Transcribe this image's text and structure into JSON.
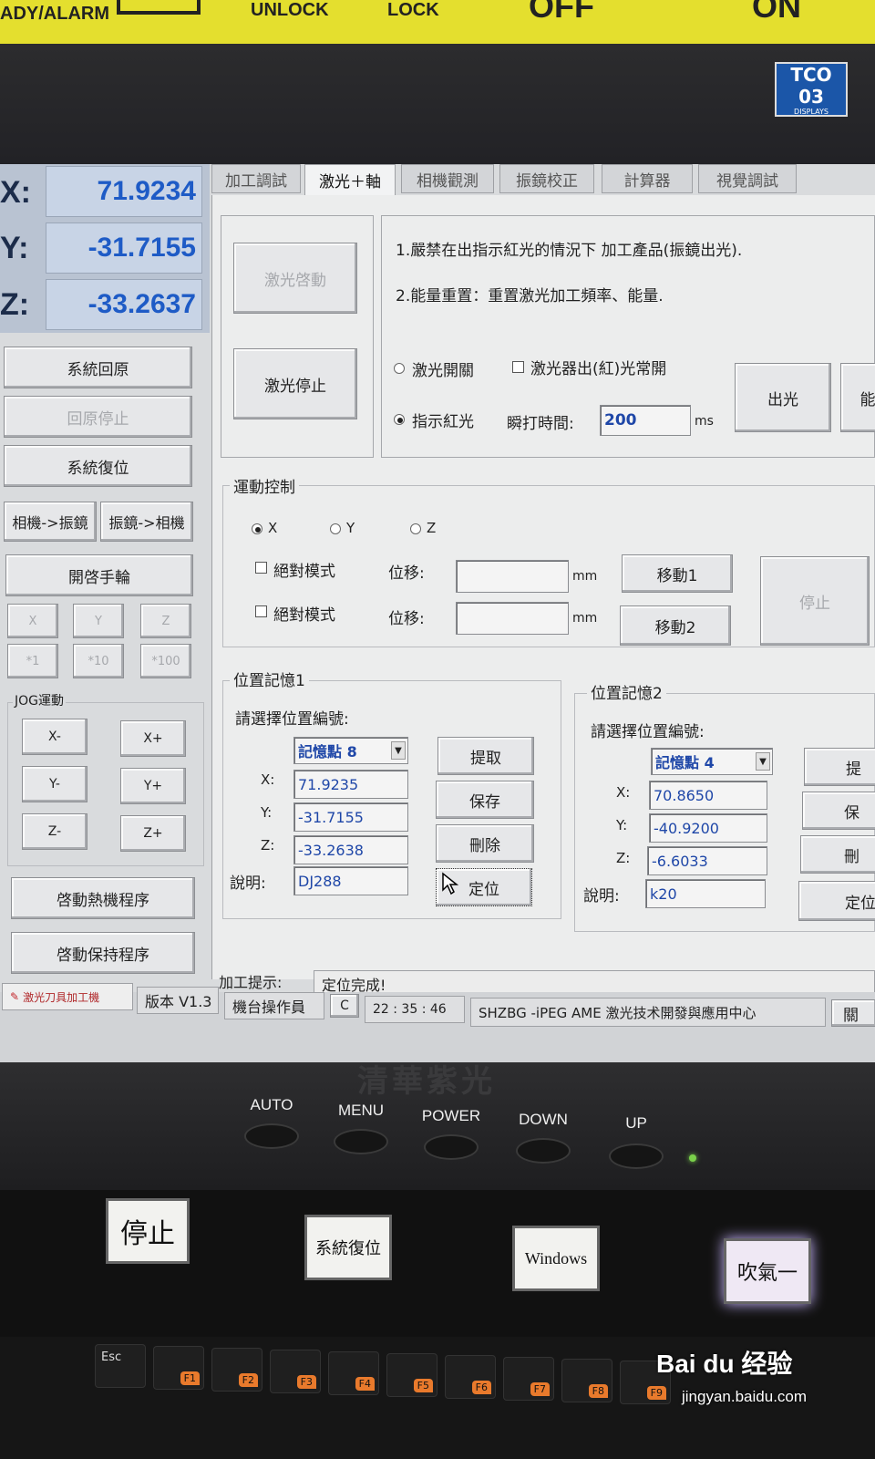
{
  "machine": {
    "top_labels": [
      "ADY/ALARM",
      "UNLOCK",
      "LOCK",
      "OFF",
      "ON"
    ],
    "tco": {
      "brand": "TCO 03",
      "sub": "DISPLAYS"
    },
    "logo_text": "清華紫光",
    "hw_buttons": [
      "AUTO",
      "MENU",
      "POWER",
      "DOWN",
      "UP"
    ],
    "panel_keys": [
      "停止",
      "系統復位",
      "Windows",
      "吹氣一"
    ],
    "keyboard_keys": [
      "Esc",
      "F1",
      "F2",
      "F3",
      "F4",
      "F5",
      "F6",
      "F7",
      "F8",
      "F9"
    ],
    "watermark": {
      "brand": "Bai du 经验",
      "url": "jingyan.baidu.com"
    }
  },
  "readouts": [
    {
      "axis": "X:",
      "value": "71.9234"
    },
    {
      "axis": "Y:",
      "value": "-31.7155"
    },
    {
      "axis": "Z:",
      "value": "-33.2637"
    }
  ],
  "left_panel": {
    "buttons": [
      "系統回原",
      "回原停止",
      "系統復位"
    ],
    "camera_to_galvo": "相機->振鏡",
    "galvo_to_camera": "振鏡->相機",
    "handwheel": "開啓手輪",
    "axis_select": [
      "X",
      "Y",
      "Z"
    ],
    "step_select": [
      "*1",
      "*10",
      "*100"
    ],
    "jog_title": "JOG運動",
    "jog_buttons": [
      "X-",
      "X+",
      "Y-",
      "Y+",
      "Z-",
      "Z+"
    ],
    "warm_program": "啓動熱機程序",
    "hold_program": "啓動保持程序"
  },
  "tabs": [
    "加工調試",
    "激光＋軸",
    "相機觀測",
    "振鏡校正",
    "計算器",
    "視覺調試"
  ],
  "laser": {
    "start": "激光啓動",
    "stop": "激光停止",
    "note1": "1.嚴禁在出指示紅光的情況下 加工產品(振鏡出光).",
    "note2": "2.能量重置：重置激光加工頻率、能量.",
    "radio_switch": "激光開關",
    "check_red": "激光器出(紅)光常開",
    "radio_red": "指示紅光",
    "pulse_label": "瞬打時間:",
    "pulse_value": "200",
    "pulse_unit": "ms",
    "emit": "出光",
    "cut_off": "能"
  },
  "motion": {
    "title": "運動控制",
    "axes": [
      "X",
      "Y",
      "Z"
    ],
    "abs_mode": "絕對模式",
    "disp_label": "位移:",
    "unit": "mm",
    "move1": "移動1",
    "move2": "移動2",
    "stop": "停止"
  },
  "memory1": {
    "title": "位置記憶1",
    "prompt": "請選擇位置編號:",
    "selected": "記憶點 8",
    "x_label": "X:",
    "x": "71.9235",
    "y_label": "Y:",
    "y": "-31.7155",
    "z_label": "Z:",
    "z": "-33.2638",
    "desc_label": "說明:",
    "desc": "DJ288",
    "fetch": "提取",
    "save": "保存",
    "delete": "刪除",
    "locate": "定位"
  },
  "memory2": {
    "title": "位置記憶2",
    "prompt": "請選擇位置編號:",
    "selected": "記憶點 4",
    "x_label": "X:",
    "x": "70.8650",
    "y_label": "Y:",
    "y": "-40.9200",
    "z_label": "Z:",
    "z": "-6.6033",
    "desc_label": "說明:",
    "desc": "k20",
    "fetch": "提",
    "save": "保",
    "delete": "刪",
    "locate": "定位"
  },
  "hint": {
    "label": "加工提示:",
    "message": "定位完成!"
  },
  "statusbar": {
    "app": "激光刀具加工機",
    "version": "版本 V1.3",
    "operator": "機台操作員",
    "mode": "C",
    "time": "22 : 35 : 46",
    "company": "SHZBG -iPEG AME 激光技术開發與應用中心",
    "close": "關"
  }
}
